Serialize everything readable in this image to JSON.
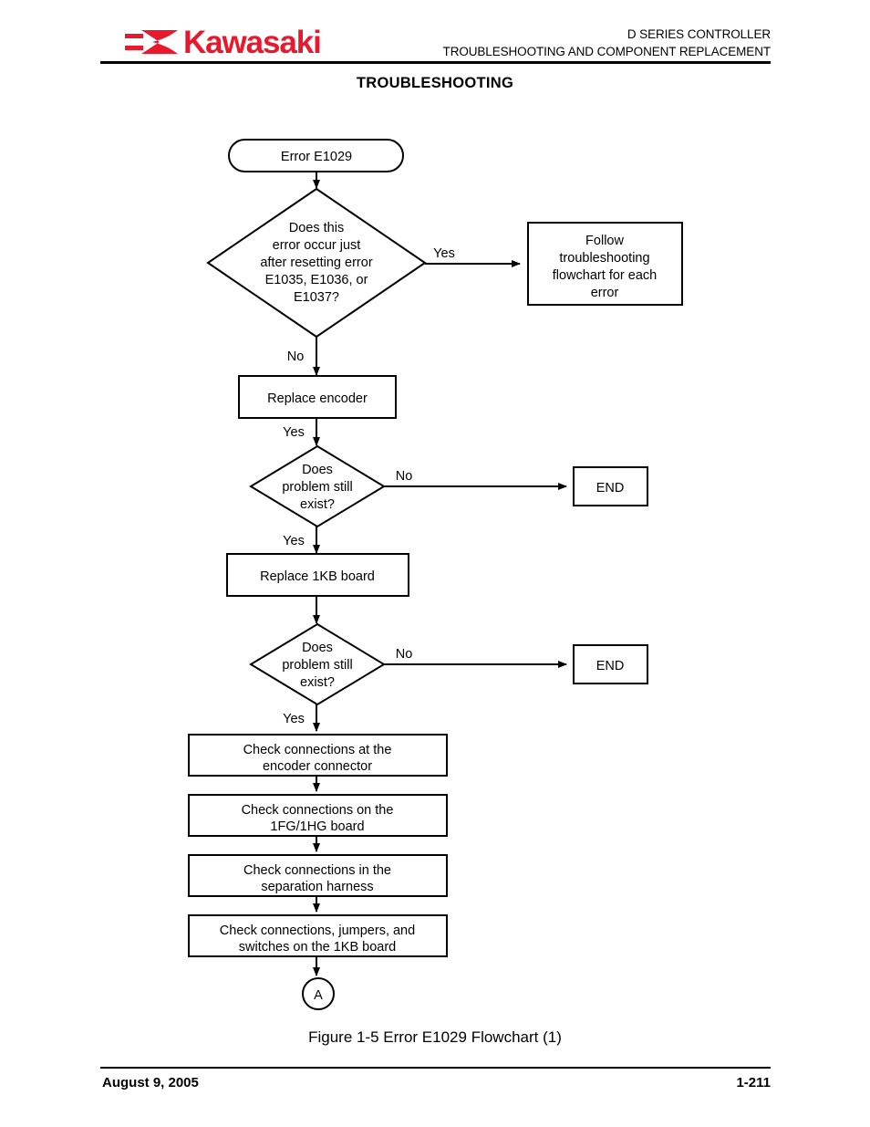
{
  "header": {
    "logo_text": "Kawasaki",
    "logo_icon": "kawasaki-river-mark",
    "logo_color": "#e8192c",
    "doc_line1": "D SERIES CONTROLLER",
    "doc_line2": "TROUBLESHOOTING AND COMPONENT REPLACEMENT",
    "section_title": "TROUBLESHOOTING"
  },
  "flowchart": {
    "start": {
      "label": "Error E1029"
    },
    "decision1": {
      "lines": [
        "Does this",
        "error occur just",
        "after resetting error",
        "E1035, E1036, or",
        "E1037?"
      ],
      "yes_label": "Yes",
      "no_label": "No"
    },
    "follow_box": {
      "lines": [
        "Follow",
        "troubleshooting",
        "flowchart for each",
        "error"
      ]
    },
    "replace_encoder": {
      "label": "Replace encoder",
      "out_label": "Yes"
    },
    "decision2": {
      "lines": [
        "Does",
        "problem still",
        "exist?"
      ],
      "no_label": "No",
      "yes_label": "Yes"
    },
    "end1": {
      "label": "END"
    },
    "replace_1kb": {
      "label": "Replace 1KB board"
    },
    "decision3": {
      "lines": [
        "Does",
        "problem still",
        "exist?"
      ],
      "no_label": "No",
      "yes_label": "Yes"
    },
    "end2": {
      "label": "END"
    },
    "check1": {
      "lines": [
        "Check connections at the",
        "encoder connector"
      ]
    },
    "check2": {
      "lines": [
        "Check connections on the",
        "1FG/1HG board"
      ]
    },
    "check3": {
      "lines": [
        "Check connections in the",
        "separation harness"
      ]
    },
    "check4": {
      "lines": [
        "Check connections, jumpers, and",
        "switches on the 1KB board"
      ]
    },
    "connector_a": {
      "label": "A"
    }
  },
  "caption": "Figure 1-5  Error E1029 Flowchart (1)",
  "footer": {
    "date": "August 9, 2005",
    "page": "1-211"
  }
}
